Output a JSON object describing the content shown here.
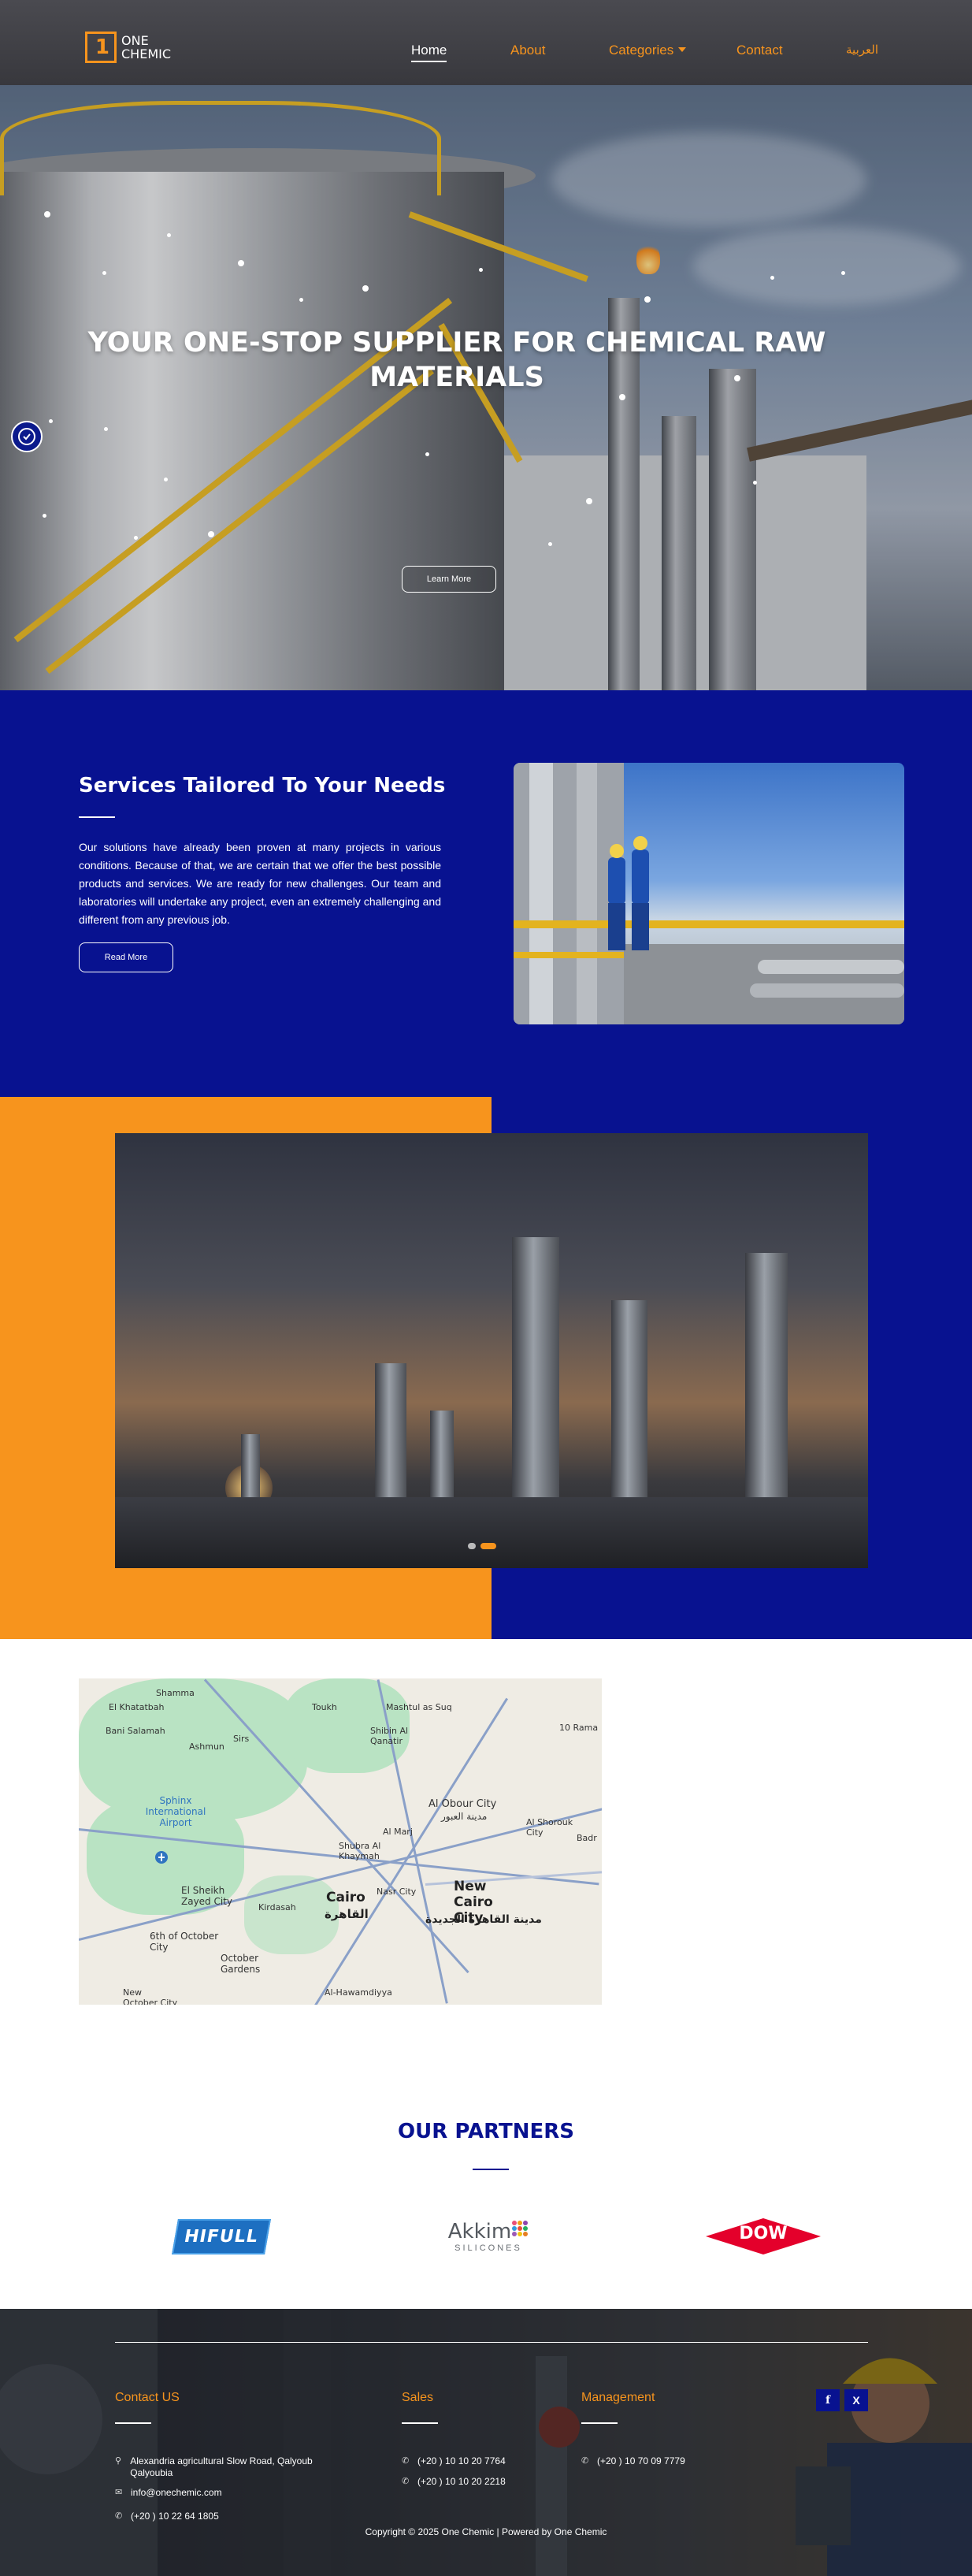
{
  "nav": {
    "logo_line1": "ONE",
    "logo_line2": "CHEMIC",
    "logo_digit": "1",
    "links": {
      "home": "Home",
      "about": "About",
      "categories": "Categories",
      "contact": "Contact",
      "arabic": "العربية"
    }
  },
  "hero": {
    "title": "YOUR ONE-STOP SUPPLIER FOR CHEMICAL RAW MATERIALS",
    "button": "Learn More"
  },
  "services": {
    "title": "Services Tailored To Your Needs",
    "text": "Our solutions have already been proven at many projects in various conditions. Because of that, we are certain that we offer the best possible products and services. We are ready for new challenges. Our team and laboratories will undertake any project, even an extremely challenging and different from any previous job.",
    "button": "Read More"
  },
  "gallery": {
    "slides": 2,
    "active": 2
  },
  "map": {
    "labels": {
      "shamma": "Shamma",
      "khatatbah": "El Khatatbah",
      "bani_salamah": "Bani Salamah",
      "ashmun": "Ashmun",
      "sirs": "Sirs",
      "toukh": "Toukh",
      "mashtul": "Mashtul as Suq",
      "shibin": "Shibin Al Qanatir",
      "obour": "Al Obour City",
      "obour_ar": "مدينة العبور",
      "sphinx": "Sphinx International Airport",
      "shorouk": "Al Shorouk City",
      "shubra": "Shubra Al Khaymah",
      "marg": "Al Marj",
      "sheikh_zayed": "El Sheikh Zayed City",
      "october": "6th of October City",
      "kirdasah": "Kirdasah",
      "cairo": "Cairo",
      "cairo_ar": "القاهرة",
      "new_cairo": "New Cairo City",
      "new_cairo_ar": "مدينة القاهرة الجديدة",
      "nasr": "Nasr City",
      "october_gardens": "October Gardens",
      "hawamdiyah": "Al-Hawamdiyya",
      "new_october": "New October City",
      "badr": "Badr",
      "ramadan": "10 Rama"
    }
  },
  "partners": {
    "title": "OUR PARTNERS",
    "hifull": "HIFULL",
    "akkim": "Akkim",
    "akkim_sub": "SILICONES",
    "dow": "DOW"
  },
  "footer": {
    "contact_title": "Contact US",
    "sales_title": "Sales",
    "management_title": "Management",
    "address": "Alexandria agricultural Slow Road, Qalyoub Qalyoubia",
    "email": "info@onechemic.com",
    "contact_phone": "(+20 ) 10 22 64 1805",
    "sales_phone1": "(+20 ) 10 10 20 7764",
    "sales_phone2": "(+20 ) 10 10 20 2218",
    "management_phone": "(+20 ) 10 70 09 7779",
    "facebook": "f",
    "x": "X",
    "copyright": "Copyright © 2025 One Chemic | Powered by One Chemic"
  },
  "colors": {
    "navy": "#081290",
    "orange": "#f7941d",
    "white": "#ffffff",
    "dow_red": "#e4002b",
    "hifull_blue": "#1d6fc1"
  },
  "icons": [
    "accessibility-icon",
    "location-icon",
    "email-icon",
    "phone-icon",
    "facebook-icon",
    "x-icon",
    "chevron-down-icon"
  ]
}
